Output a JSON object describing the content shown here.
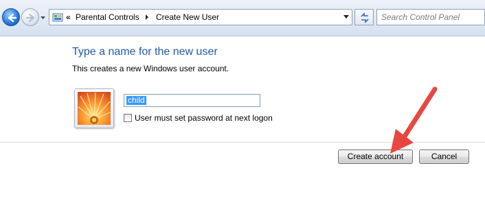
{
  "navigation": {
    "breadcrumb_chevron": "«",
    "breadcrumb": [
      "Parental Controls",
      "Create New User"
    ],
    "search_placeholder": "Search Control Panel"
  },
  "form": {
    "heading": "Type a name for the new user",
    "subheading": "This creates a new Windows user account.",
    "username_value": "child",
    "checkbox_label": "User must set password at next logon",
    "checkbox_checked": false
  },
  "buttons": {
    "create_label": "Create account",
    "cancel_label": "Cancel"
  },
  "colors": {
    "heading": "#1e5aa8",
    "selection_highlight": "#3399ff",
    "annotation_arrow": "#e8473f"
  }
}
